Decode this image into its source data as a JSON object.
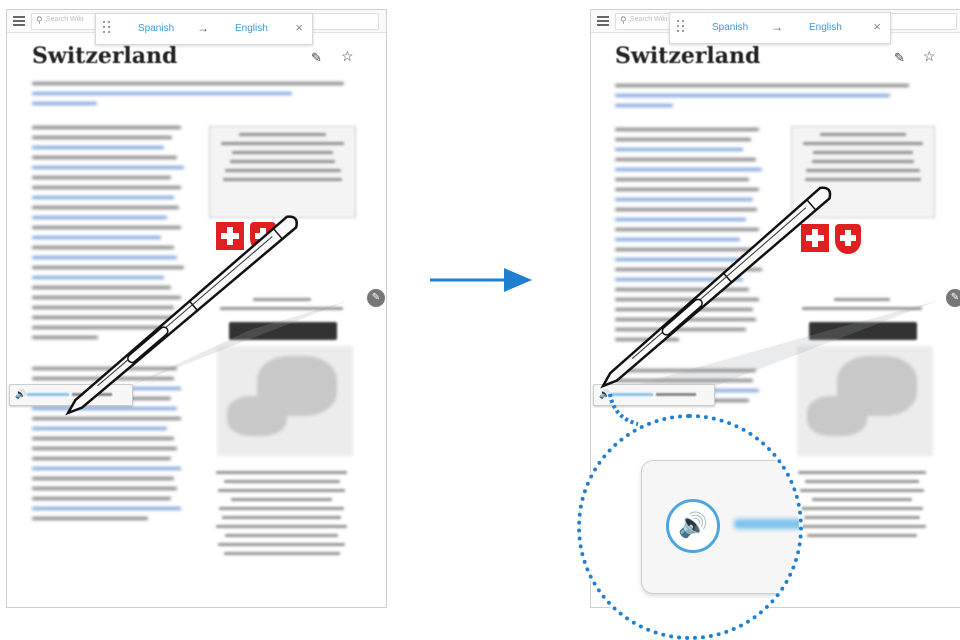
{
  "left_screen": {
    "search_placeholder": "Search Wiki",
    "translator": {
      "source_lang": "Spanish",
      "arrow": "→",
      "target_lang": "English",
      "close": "×"
    },
    "article_title": "Switzerland",
    "edit_icon": "✎",
    "star_icon": "☆"
  },
  "right_screen": {
    "search_placeholder": "Search Wiki",
    "translator": {
      "source_lang": "Spanish",
      "arrow": "→",
      "target_lang": "English",
      "close": "×"
    },
    "article_title": "Switzerland",
    "edit_icon": "✎",
    "star_icon": "☆"
  },
  "icons": {
    "speaker": "🔊",
    "side_edit": "✎"
  },
  "colors": {
    "accent_blue": "#1f7fd0",
    "link_blue": "#3a9ad9",
    "flag_red": "#e02020"
  }
}
